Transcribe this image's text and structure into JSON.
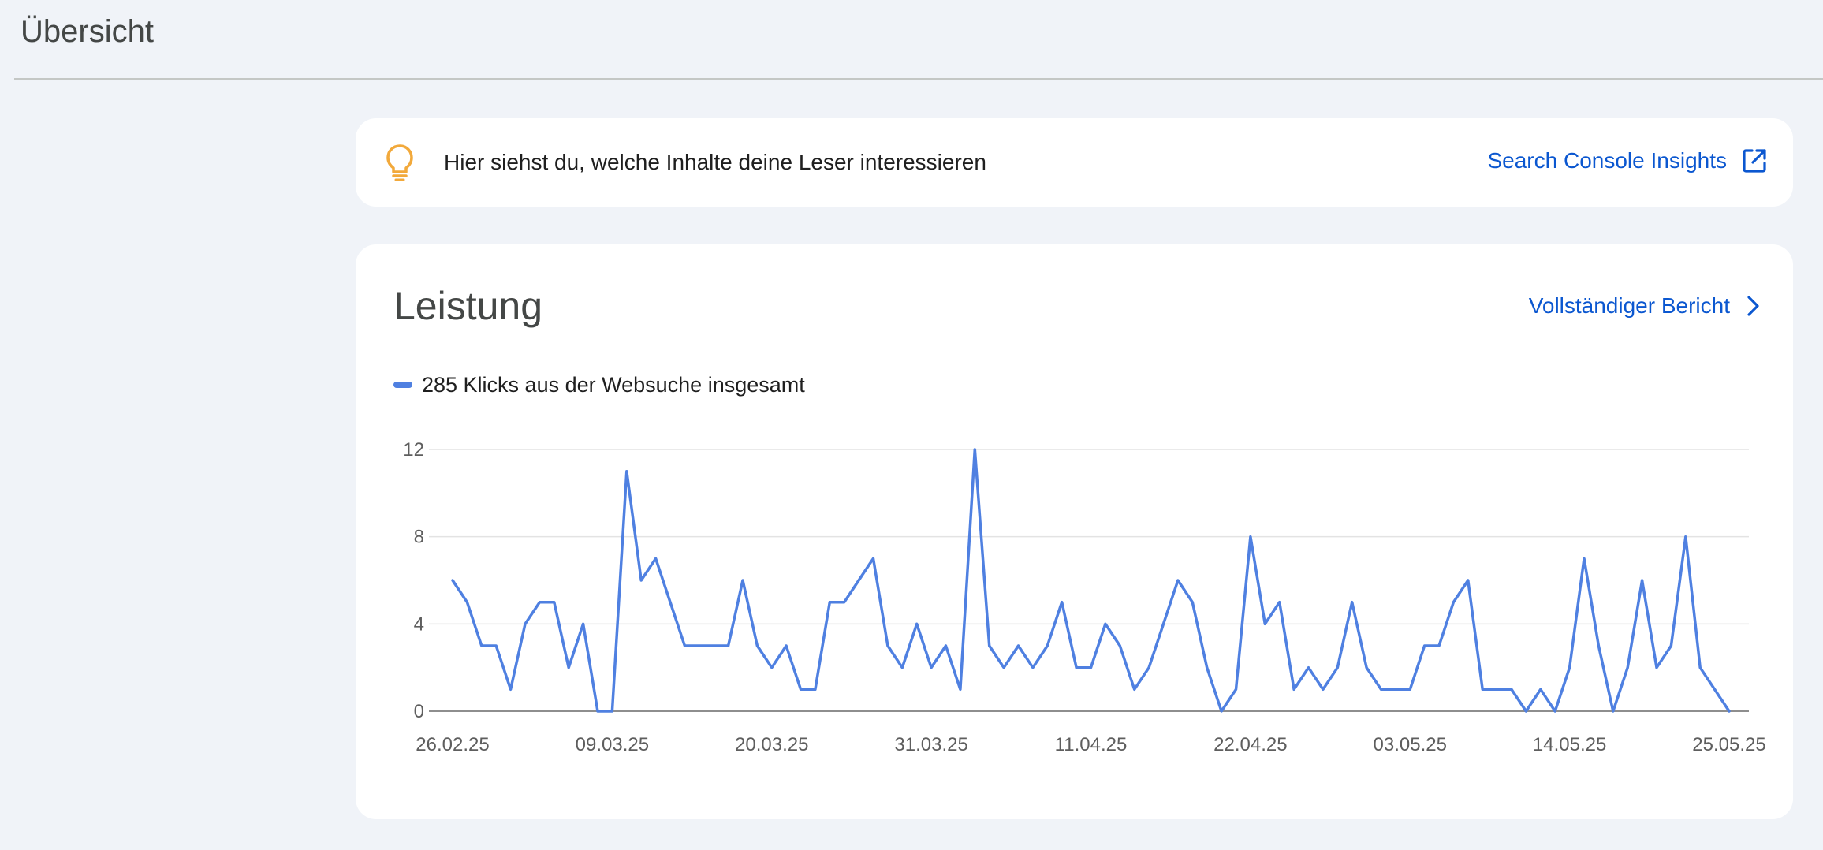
{
  "header": {
    "title": "Übersicht"
  },
  "insight": {
    "text": "Hier siehst du, welche Inhalte deine Leser interessieren",
    "link_label": "Search Console Insights",
    "icon": "lightbulb-icon",
    "link_icon": "external-link-icon"
  },
  "performance": {
    "title": "Leistung",
    "report_link": "Vollständiger Bericht",
    "report_icon": "chevron-right-icon",
    "legend_label": "285 Klicks aus der Websuche insgesamt"
  },
  "colors": {
    "background": "#f0f3f8",
    "card": "#ffffff",
    "accent": "#0b57d0",
    "series": "#4f80e1",
    "bulb": "#f2a93b"
  },
  "chart_data": {
    "type": "line",
    "x_start": "26.02.25",
    "x_end": "25.05.25",
    "x_tick_labels": [
      "26.02.25",
      "09.03.25",
      "20.03.25",
      "31.03.25",
      "11.04.25",
      "22.04.25",
      "03.05.25",
      "14.05.25",
      "25.05.25"
    ],
    "y_ticks": [
      0,
      4,
      8,
      12
    ],
    "ylim": [
      0,
      12
    ],
    "grid": true,
    "series": [
      {
        "name": "Klicks",
        "values": [
          6,
          5,
          3,
          3,
          1,
          4,
          5,
          5,
          2,
          4,
          0,
          0,
          11,
          6,
          7,
          5,
          3,
          3,
          3,
          3,
          6,
          3,
          2,
          3,
          1,
          1,
          5,
          5,
          6,
          7,
          3,
          2,
          4,
          2,
          3,
          1,
          12,
          3,
          2,
          3,
          2,
          3,
          5,
          2,
          2,
          4,
          3,
          1,
          2,
          4,
          6,
          5,
          2,
          0,
          1,
          8,
          4,
          5,
          1,
          2,
          1,
          2,
          5,
          2,
          1,
          1,
          1,
          3,
          3,
          5,
          6,
          1,
          1,
          1,
          0,
          1,
          0,
          2,
          7,
          3,
          0,
          2,
          6,
          2,
          3,
          8,
          2,
          1,
          0
        ]
      }
    ]
  }
}
